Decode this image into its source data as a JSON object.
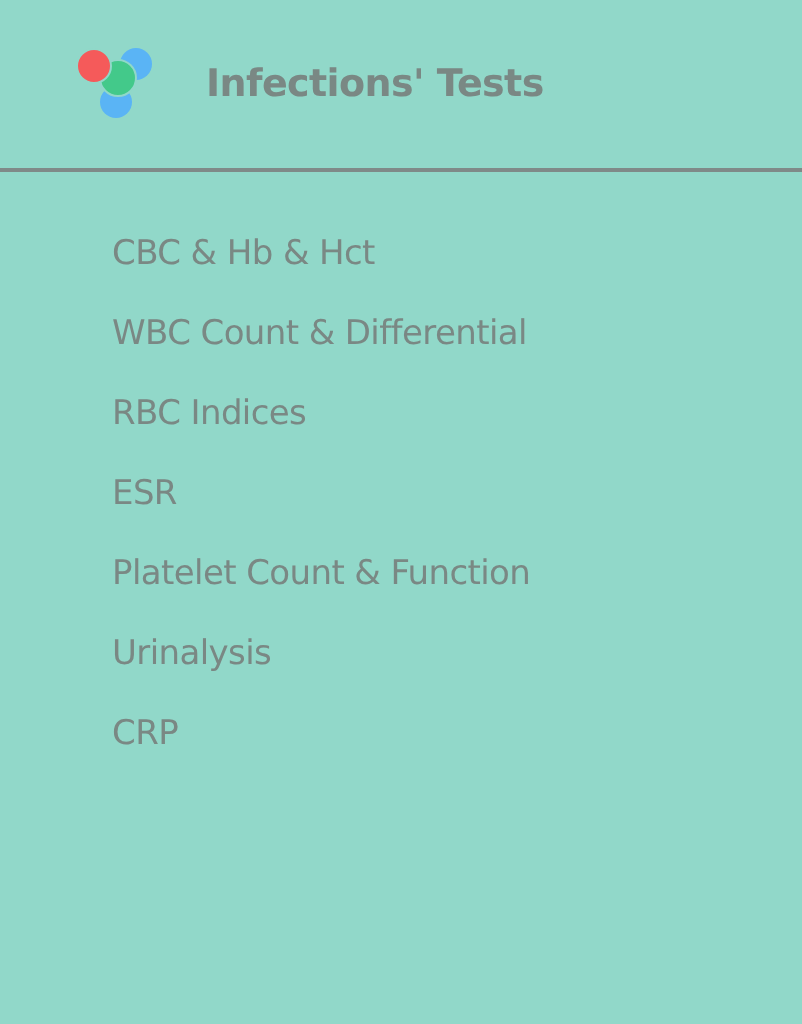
{
  "header": {
    "title": "Infections' Tests"
  },
  "menu": [
    {
      "label": "CBC & Hb & Hct"
    },
    {
      "label": "WBC Count & Differential"
    },
    {
      "label": "RBC Indices"
    },
    {
      "label": "ESR"
    },
    {
      "label": "Platelet Count & Function"
    },
    {
      "label": "Urinalysis"
    },
    {
      "label": "CRP"
    }
  ]
}
